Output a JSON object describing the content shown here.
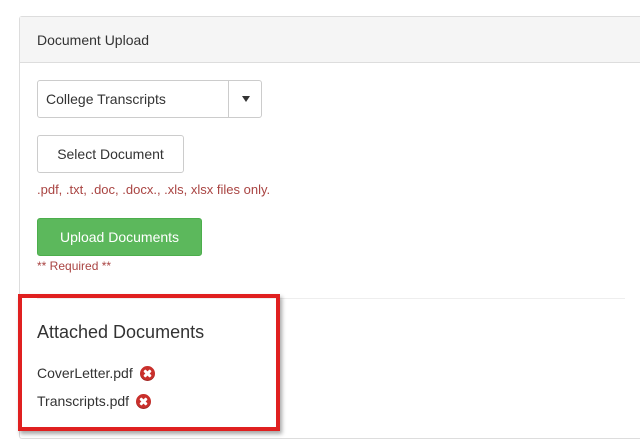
{
  "panel": {
    "title": "Document Upload"
  },
  "document_type": {
    "selected": "College Transcripts"
  },
  "buttons": {
    "select_document": "Select Document",
    "upload_documents": "Upload Documents"
  },
  "help": {
    "file_types": ".pdf, .txt, .doc, .docx., .xls, xlsx files only.",
    "required": "** Required **"
  },
  "attached": {
    "title": "Attached Documents",
    "items": [
      {
        "name": "CoverLetter.pdf",
        "icon": "remove-circle-icon"
      },
      {
        "name": "Transcripts.pdf",
        "icon": "remove-circle-icon"
      }
    ]
  },
  "colors": {
    "success": "#5cb85c",
    "error_text": "#a94442",
    "remove_icon": "#c9302c",
    "highlight": "#e02020"
  }
}
